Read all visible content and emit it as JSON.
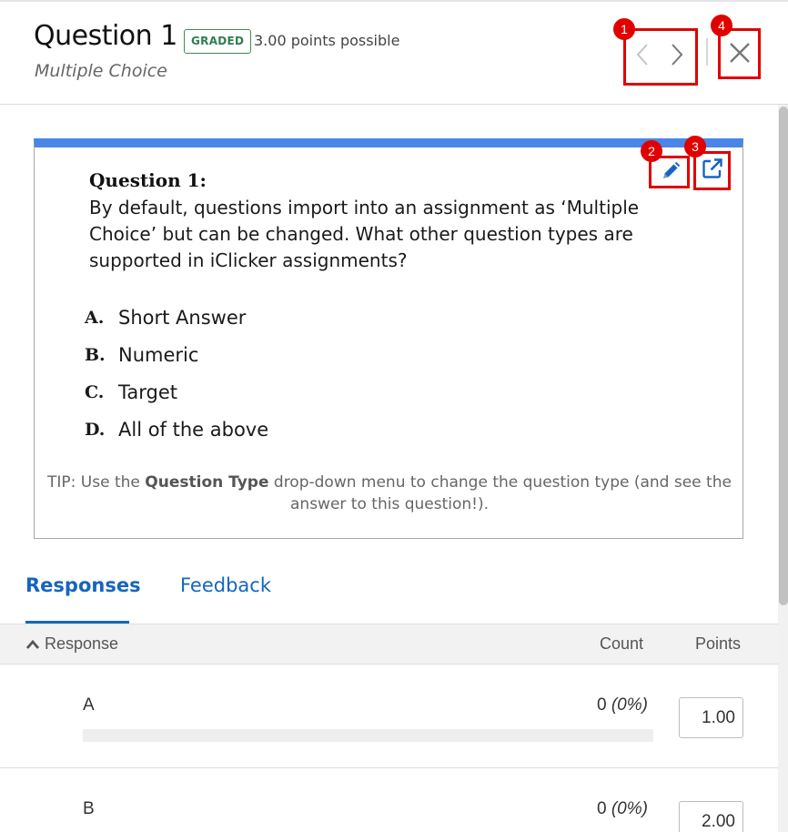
{
  "header": {
    "title": "Question 1",
    "badge": "GRADED",
    "points": "3.00 points possible",
    "subtitle": "Multiple Choice"
  },
  "markers": {
    "nav": "1",
    "edit": "2",
    "external": "3",
    "close": "4"
  },
  "question": {
    "heading": "Question 1:",
    "body": "By default, questions import into an assignment as ‘Multiple Choice’ but can be changed. What other question types are supported in iClicker assignments?",
    "choices": [
      {
        "letter": "A.",
        "text": "Short Answer"
      },
      {
        "letter": "B.",
        "text": "Numeric"
      },
      {
        "letter": "C.",
        "text": "Target"
      },
      {
        "letter": "D.",
        "text": "All of the above"
      }
    ],
    "tip_prefix": "TIP: Use the ",
    "tip_bold": "Question Type",
    "tip_suffix": " drop-down menu to change the question type (and see the answer to this question!)."
  },
  "tabs": [
    {
      "label": "Responses"
    },
    {
      "label": "Feedback"
    }
  ],
  "table": {
    "headers": {
      "response": "Response",
      "count": "Count",
      "points": "Points"
    },
    "rows": [
      {
        "label": "A",
        "count": "0",
        "percent": "(0%)",
        "points": "1.00"
      },
      {
        "label": "B",
        "count": "0",
        "percent": "(0%)",
        "points": "2.00"
      }
    ]
  },
  "colors": {
    "accent": "#1565c0",
    "card_top": "#4a86e8",
    "badge": "#2e7d4f",
    "annotation": "#e00000"
  },
  "icons": {
    "prev": "chevron-left-icon",
    "next": "chevron-right-icon",
    "close": "close-icon",
    "edit": "pencil-icon",
    "external": "external-link-icon",
    "sort": "chevron-up-icon"
  }
}
